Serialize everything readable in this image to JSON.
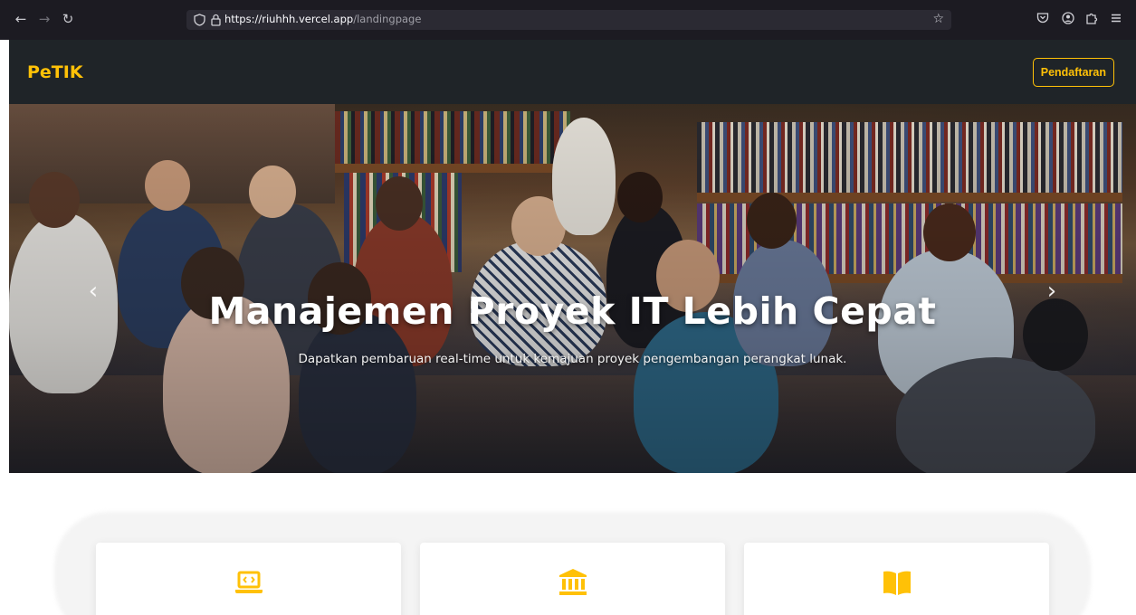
{
  "browser": {
    "url_host": "https://riuhhh.vercel.app",
    "url_path": "/landingpage"
  },
  "site": {
    "brand": "PeTIK",
    "register_label": "Pendaftaran"
  },
  "hero": {
    "title": "Manajemen Proyek IT Lebih Cepat",
    "subtitle": "Dapatkan pembaruan real-time untuk kemajuan proyek pengembangan perangkat lunak."
  },
  "features": {
    "cards": [
      {
        "icon": "laptop-code-icon"
      },
      {
        "icon": "building-columns-icon"
      },
      {
        "icon": "open-book-icon"
      }
    ]
  },
  "colors": {
    "accent": "#ffc107",
    "nav_bg": "#1f2428"
  }
}
